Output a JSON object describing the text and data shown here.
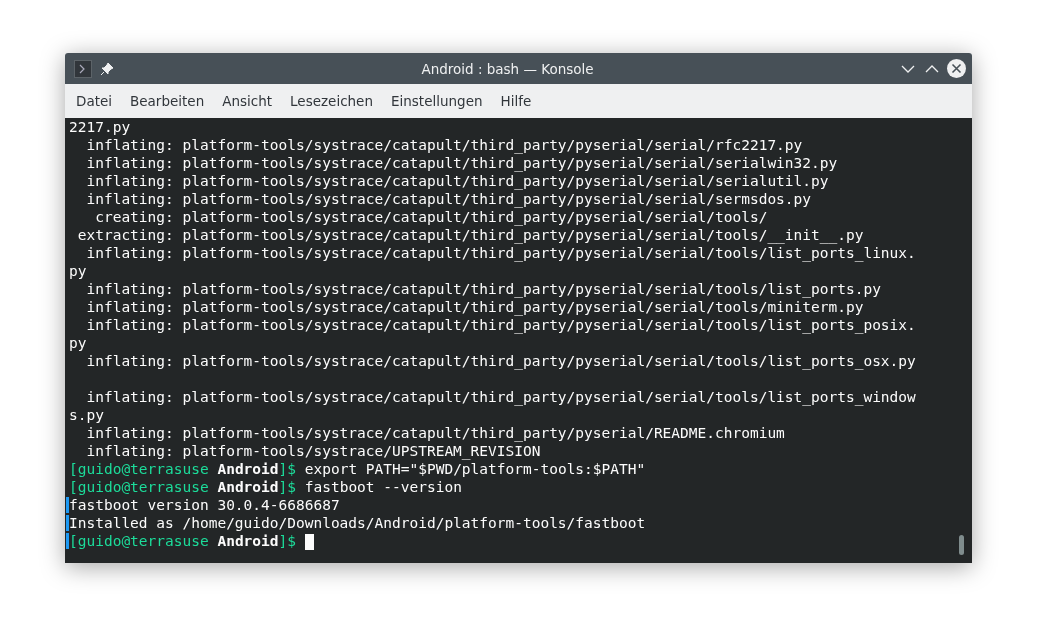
{
  "window": {
    "title": "Android : bash — Konsole"
  },
  "menu": [
    {
      "label": "Datei"
    },
    {
      "label": "Bearbeiten"
    },
    {
      "label": "Ansicht"
    },
    {
      "label": "Lesezeichen"
    },
    {
      "label": "Einstellungen"
    },
    {
      "label": "Hilfe"
    }
  ],
  "terminal": {
    "lines": [
      {
        "kind": "output",
        "text": "2217.py",
        "marked": false
      },
      {
        "kind": "output",
        "text": "  inflating: platform-tools/systrace/catapult/third_party/pyserial/serial/rfc2217.py",
        "marked": false
      },
      {
        "kind": "output",
        "text": "  inflating: platform-tools/systrace/catapult/third_party/pyserial/serial/serialwin32.py",
        "marked": false
      },
      {
        "kind": "output",
        "text": "  inflating: platform-tools/systrace/catapult/third_party/pyserial/serial/serialutil.py",
        "marked": false
      },
      {
        "kind": "output",
        "text": "  inflating: platform-tools/systrace/catapult/third_party/pyserial/serial/sermsdos.py",
        "marked": false
      },
      {
        "kind": "output",
        "text": "   creating: platform-tools/systrace/catapult/third_party/pyserial/serial/tools/",
        "marked": false
      },
      {
        "kind": "output",
        "text": " extracting: platform-tools/systrace/catapult/third_party/pyserial/serial/tools/__init__.py",
        "marked": false
      },
      {
        "kind": "output",
        "text": "  inflating: platform-tools/systrace/catapult/third_party/pyserial/serial/tools/list_ports_linux.",
        "marked": false
      },
      {
        "kind": "output",
        "text": "py",
        "marked": false
      },
      {
        "kind": "output",
        "text": "  inflating: platform-tools/systrace/catapult/third_party/pyserial/serial/tools/list_ports.py",
        "marked": false
      },
      {
        "kind": "output",
        "text": "  inflating: platform-tools/systrace/catapult/third_party/pyserial/serial/tools/miniterm.py",
        "marked": false
      },
      {
        "kind": "output",
        "text": "  inflating: platform-tools/systrace/catapult/third_party/pyserial/serial/tools/list_ports_posix.",
        "marked": false
      },
      {
        "kind": "output",
        "text": "py",
        "marked": false
      },
      {
        "kind": "output",
        "text": "  inflating: platform-tools/systrace/catapult/third_party/pyserial/serial/tools/list_ports_osx.py",
        "marked": false
      },
      {
        "kind": "blank",
        "marked": false
      },
      {
        "kind": "output",
        "text": "  inflating: platform-tools/systrace/catapult/third_party/pyserial/serial/tools/list_ports_window",
        "marked": false
      },
      {
        "kind": "output",
        "text": "s.py",
        "marked": false
      },
      {
        "kind": "output",
        "text": "  inflating: platform-tools/systrace/catapult/third_party/pyserial/README.chromium",
        "marked": false
      },
      {
        "kind": "output",
        "text": "  inflating: platform-tools/systrace/UPSTREAM_REVISION",
        "marked": false
      },
      {
        "kind": "prompt",
        "user": "[guido@terrasuse",
        "dir": "Android",
        "suffix": "]$",
        "command": "export PATH=\"$PWD/platform-tools:$PATH\"",
        "cursor": false,
        "marked": false
      },
      {
        "kind": "prompt",
        "user": "[guido@terrasuse",
        "dir": "Android",
        "suffix": "]$",
        "command": "fastboot --version",
        "cursor": false,
        "marked": false
      },
      {
        "kind": "output",
        "text": "fastboot version 30.0.4-6686687",
        "marked": true
      },
      {
        "kind": "output",
        "text": "Installed as /home/guido/Downloads/Android/platform-tools/fastboot",
        "marked": true
      },
      {
        "kind": "prompt",
        "user": "[guido@terrasuse",
        "dir": "Android",
        "suffix": "]$",
        "cursor": true,
        "marked": true
      }
    ]
  }
}
